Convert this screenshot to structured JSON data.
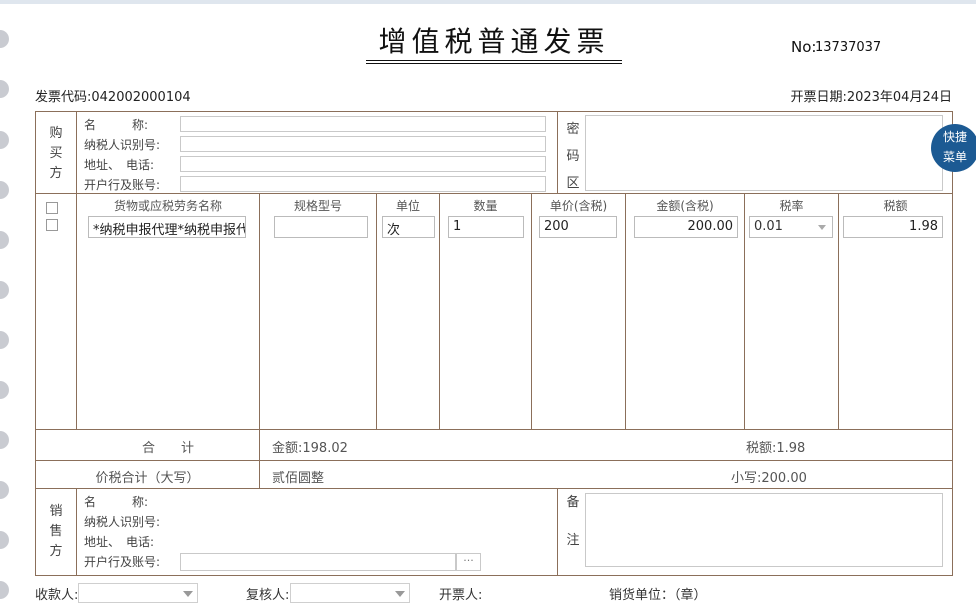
{
  "header": {
    "title": "增值税普通发票",
    "no_label": "No:",
    "no_value": "13737037",
    "invoice_code": "发票代码:042002000104",
    "invoice_date": "开票日期:2023年04月24日"
  },
  "buyer": {
    "side_label": [
      "购",
      "买",
      "方"
    ],
    "name_label": "名　　　称:",
    "taxid_label": "纳税人识别号:",
    "addr_label": "地址、　电话:",
    "bank_label": "开户行及账号:",
    "cipher_label": [
      "密",
      "码",
      "区"
    ]
  },
  "quick_menu": [
    "快捷",
    "菜单"
  ],
  "items_header": {
    "goods_name": "货物或应税劳务名称",
    "spec": "规格型号",
    "unit": "单位",
    "qty": "数量",
    "unit_price": "单价(含税)",
    "amount": "金额(含税)",
    "tax_rate": "税率",
    "tax_amount": "税额"
  },
  "item": {
    "goods_name": "*纳税申报代理*纳税申报代",
    "spec": "",
    "unit": "次",
    "qty": "1",
    "unit_price": "200",
    "amount": "200.00",
    "tax_rate": "0.01",
    "tax_amount": "1.98"
  },
  "totals": {
    "label": "合　　计",
    "amount": "金额:198.02",
    "tax": "税额:1.98",
    "total_label": "价税合计（大写）",
    "total_upper": "贰佰圆整",
    "total_lower": "小写:200.00"
  },
  "seller": {
    "side_label": [
      "销",
      "售",
      "方"
    ],
    "name_label": "名　　　称:",
    "taxid_label": "纳税人识别号:",
    "addr_label": "地址、　电话:",
    "bank_label": "开户行及账号:",
    "bank_button": "···",
    "remark_label": [
      "备",
      "注"
    ]
  },
  "footer": {
    "payee": "收款人:",
    "reviewer": "复核人:",
    "drawer": "开票人:",
    "seller_unit": "销货单位：（章）"
  }
}
